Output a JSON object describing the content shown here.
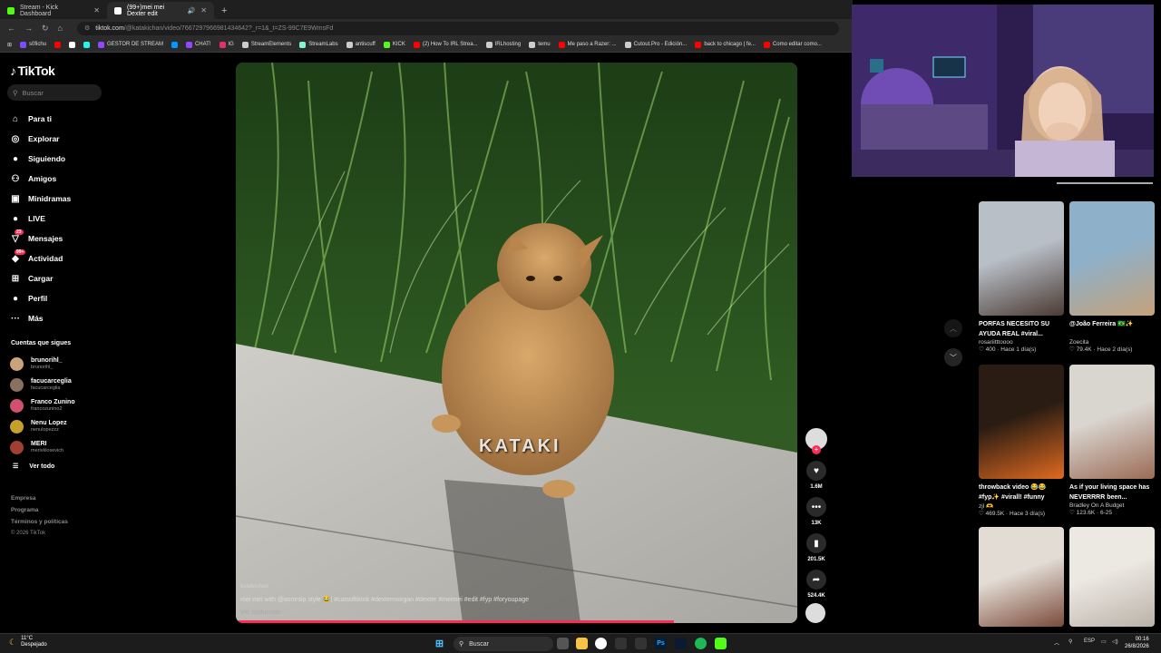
{
  "browser": {
    "tabs": [
      {
        "title": "Stream - Kick Dashboard",
        "active": false,
        "favicon_color": "#53fc18"
      },
      {
        "title": "(99+)mei mei Dexter edit",
        "active": true,
        "favicon_color": "#ffffff"
      }
    ],
    "url_host": "tiktok.com",
    "url_path": "/@katakichan/video/7667297966981434642?_r=1&_t=ZS-99C7E9WmsFd",
    "bookmarks": [
      {
        "label": "s0fichu",
        "color": "#7b4dff"
      },
      {
        "label": "",
        "color": "#ff0000"
      },
      {
        "label": "",
        "color": "#ffffff"
      },
      {
        "label": "",
        "color": "#25f4ee"
      },
      {
        "label": "GESTOR DE STREAM",
        "color": "#9146ff"
      },
      {
        "label": "",
        "color": "#0099ff"
      },
      {
        "label": "CHAT!",
        "color": "#9146ff"
      },
      {
        "label": "IG",
        "color": "#e1306c"
      },
      {
        "label": "StreamElements",
        "color": "#cccccc"
      },
      {
        "label": "StreamLabs",
        "color": "#80f5d2"
      },
      {
        "label": "antiscuff",
        "color": "#cccccc"
      },
      {
        "label": "KICK",
        "color": "#53fc18"
      },
      {
        "label": "(2) How To IRL Strea...",
        "color": "#ff0000"
      },
      {
        "label": "IRLhosting",
        "color": "#cccccc"
      },
      {
        "label": "temu",
        "color": "#cccccc"
      },
      {
        "label": "Me paso a Razer: ...",
        "color": "#ff0000"
      },
      {
        "label": "Cutout.Pro - Edición...",
        "color": "#cccccc"
      },
      {
        "label": "back to chicago | fe...",
        "color": "#ff0000"
      },
      {
        "label": "Como editar como...",
        "color": "#ff0000"
      }
    ]
  },
  "sidebar": {
    "logo": "TikTok",
    "search_placeholder": "Buscar",
    "menu": [
      {
        "label": "Para ti",
        "icon": "home-icon",
        "glyph": "⌂"
      },
      {
        "label": "Explorar",
        "icon": "compass-icon",
        "glyph": "◎"
      },
      {
        "label": "Siguiendo",
        "icon": "following-icon",
        "glyph": "●"
      },
      {
        "label": "Amigos",
        "icon": "friends-icon",
        "glyph": "⚇"
      },
      {
        "label": "Minidramas",
        "icon": "minidramas-icon",
        "glyph": "▣"
      },
      {
        "label": "LIVE",
        "icon": "live-icon",
        "glyph": "●"
      },
      {
        "label": "Mensajes",
        "icon": "messages-icon",
        "glyph": "▽",
        "badge": "23"
      },
      {
        "label": "Actividad",
        "icon": "activity-icon",
        "glyph": "◆",
        "badge": "99+"
      },
      {
        "label": "Cargar",
        "icon": "upload-icon",
        "glyph": "⊞"
      },
      {
        "label": "Perfil",
        "icon": "profile-icon",
        "glyph": "●"
      },
      {
        "label": "Más",
        "icon": "more-icon",
        "glyph": "···"
      }
    ],
    "following_header": "Cuentas que sigues",
    "following": [
      {
        "name": "brunorihl_",
        "handle": "brunorihl_",
        "color": "#c9a37a"
      },
      {
        "name": "facucarceglia",
        "handle": "facucarceglia",
        "color": "#8a7060"
      },
      {
        "name": "Franco Zunino",
        "handle": "francozunino2",
        "color": "#d05070"
      },
      {
        "name": "Nenu Lopez",
        "handle": "nenulopezzz",
        "color": "#c6a12a"
      },
      {
        "name": "MERI",
        "handle": "merivklosevich",
        "color": "#a04030"
      }
    ],
    "see_all": "Ver todo",
    "footer": [
      "Empresa",
      "Programa",
      "Términos y políticas"
    ],
    "copyright": "© 2026 TikTok"
  },
  "video": {
    "watermark": "KATAKI",
    "author": "katakichan",
    "caption": "mei mei with @asmrsip style 😂| #catsoftiktok #dextermorgan #dexter #meimei #edit #fyp #foryoupage",
    "translate": "Ver traducción",
    "progress": 0.78,
    "actions": [
      {
        "name": "like",
        "icon": "heart-icon",
        "glyph": "♥",
        "count": "1.6M"
      },
      {
        "name": "comment",
        "icon": "comment-icon",
        "glyph": "•••",
        "count": "13K"
      },
      {
        "name": "save",
        "icon": "bookmark-icon",
        "glyph": "▮",
        "count": "201.5K"
      },
      {
        "name": "share",
        "icon": "share-icon",
        "glyph": "➦",
        "count": "524.4K"
      }
    ]
  },
  "related": [
    {
      "title": "PORFAS NECESITO SU AYUDA REAL #viral...",
      "author": "rosariitttoooo",
      "stats": "400 · Hace 1 día(s)",
      "colors": [
        "#b8bfc7",
        "#4b3a33"
      ]
    },
    {
      "title": "@João Ferreira 🇧🇷✨",
      "author": "Zoecita",
      "stats": "79.4K · Hace 2 día(s)",
      "colors": [
        "#8fb0c9",
        "#c4a27a"
      ]
    },
    {
      "title": "throwback video 😂😂 #fyp✨ #virall! #funny",
      "author": "zjl 🫶",
      "stats": "469.5K · Hace 3 día(s)",
      "colors": [
        "#2a1c12",
        "#e06a20"
      ]
    },
    {
      "title": "As if your living space has NEVERRRR been...",
      "author": "Bradley On A Budget",
      "stats": "123.6K · 6-25",
      "colors": [
        "#d9d5cf",
        "#9b6b55"
      ]
    },
    {
      "title": "",
      "author": "",
      "stats": "",
      "colors": [
        "#e2dcd4",
        "#7b4a3a"
      ]
    },
    {
      "title": "",
      "author": "",
      "stats": "",
      "colors": [
        "#ece8e2",
        "#b9b2a8"
      ]
    }
  ],
  "taskbar": {
    "temp": "11°C",
    "weather": "Despejado",
    "search": "Buscar",
    "lang": "ESP",
    "time": "00:16",
    "date": "26/8/2026"
  }
}
